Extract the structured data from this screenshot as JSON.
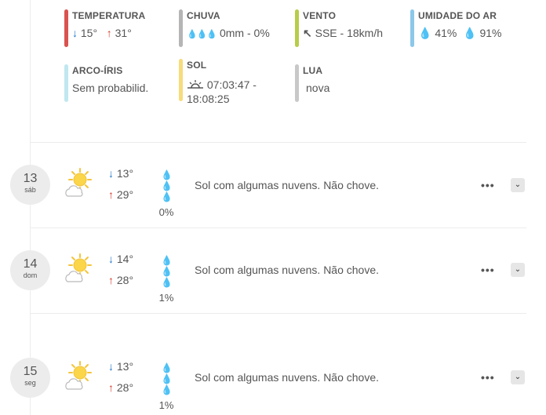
{
  "details": {
    "temperatura": {
      "title": "TEMPERATURA",
      "min": "15°",
      "max": "31°",
      "color": "#d9534f"
    },
    "chuva": {
      "title": "CHUVA",
      "value": "0mm - 0%",
      "color": "#b5b5b5"
    },
    "vento": {
      "title": "VENTO",
      "value": "SSE - 18km/h",
      "color": "#b8cc4a"
    },
    "umidade": {
      "title": "UMIDADE DO AR",
      "min": "41%",
      "max": "91%",
      "color": "#8cc8ea"
    },
    "arco_iris": {
      "title": "ARCO-ÍRIS",
      "value": "Sem probabilid.",
      "color": "#bfe8f0"
    },
    "sol": {
      "title": "SOL",
      "value_line1": "07:03:47 -",
      "value_line2": "18:08:25",
      "color": "#f6dc7a"
    },
    "lua": {
      "title": "LUA",
      "value": "nova",
      "color": "#c8c8c8"
    }
  },
  "days": [
    {
      "day": "13",
      "weekday": "sáb",
      "min": "13°",
      "max": "29°",
      "rain": "0%",
      "description": "Sol com algumas nuvens. Não chove.",
      "icon": "sun-cloud-icon"
    },
    {
      "day": "14",
      "weekday": "dom",
      "min": "14°",
      "max": "28°",
      "rain": "1%",
      "description": "Sol com algumas nuvens. Não chove.",
      "icon": "sun-cloud-icon"
    },
    {
      "day": "15",
      "weekday": "seg",
      "min": "13°",
      "max": "28°",
      "rain": "1%",
      "description": "Sol com algumas nuvens. Não chove.",
      "icon": "sun-cloud-icon"
    }
  ],
  "actions": {
    "more": "•••",
    "expand": "⌄"
  }
}
